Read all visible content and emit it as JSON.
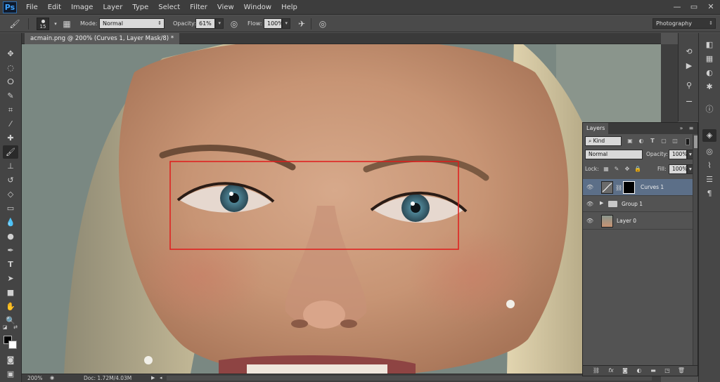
{
  "app": {
    "logo": "Ps"
  },
  "menu": [
    "File",
    "Edit",
    "Image",
    "Layer",
    "Type",
    "Select",
    "Filter",
    "View",
    "Window",
    "Help"
  ],
  "window_controls": {
    "minimize": "—",
    "maximize": "▭",
    "close": "✕"
  },
  "options": {
    "brush_size": "15",
    "mode_label": "Mode:",
    "mode_value": "Normal",
    "opacity_label": "Opacity:",
    "opacity_value": "61%",
    "flow_label": "Flow:",
    "flow_value": "100%",
    "workspace": "Photography"
  },
  "document": {
    "tab_title": "acmain.png @ 200% (Curves 1, Layer Mask/8) *",
    "zoom": "200%",
    "doc_info": "Doc: 1.72M/4.03M"
  },
  "selection": {
    "color": "#e01b1b"
  },
  "layers_panel": {
    "title": "Layers",
    "filter_kind": "Kind",
    "blend_mode": "Normal",
    "opacity_label": "Opacity:",
    "opacity_value": "100%",
    "lock_label": "Lock:",
    "fill_label": "Fill:",
    "fill_value": "100%",
    "layers": [
      {
        "name": "Curves 1",
        "type": "adjustment",
        "selected": true
      },
      {
        "name": "Group 1",
        "type": "group",
        "selected": false
      },
      {
        "name": "Layer 0",
        "type": "pixel",
        "selected": false
      }
    ]
  },
  "colors": {
    "accent": "#3ea3ff",
    "selected_layer": "#5c6f88",
    "foreground": "#000000",
    "background": "#ffffff"
  }
}
